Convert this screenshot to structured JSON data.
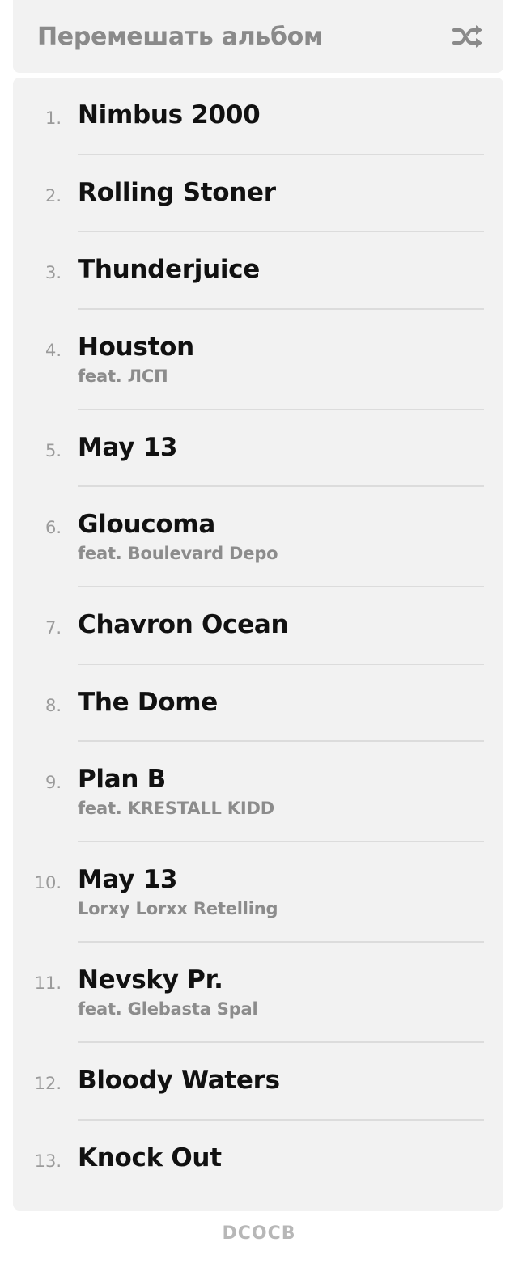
{
  "shuffle": {
    "label": "Перемешать альбом",
    "icon": "shuffle-icon"
  },
  "tracks": [
    {
      "num": "1.",
      "title": "Nimbus 2000",
      "subtitle": ""
    },
    {
      "num": "2.",
      "title": "Rolling Stoner",
      "subtitle": ""
    },
    {
      "num": "3.",
      "title": "Thunderjuice",
      "subtitle": ""
    },
    {
      "num": "4.",
      "title": "Houston",
      "subtitle": "feat. ЛСП"
    },
    {
      "num": "5.",
      "title": "May 13",
      "subtitle": ""
    },
    {
      "num": "6.",
      "title": "Gloucoma",
      "subtitle": "feat. Boulevard Depo"
    },
    {
      "num": "7.",
      "title": "Chavron Ocean",
      "subtitle": ""
    },
    {
      "num": "8.",
      "title": "The Dome",
      "subtitle": ""
    },
    {
      "num": "9.",
      "title": "Plan B",
      "subtitle": "feat. KRESTALL KIDD"
    },
    {
      "num": "10.",
      "title": "May 13",
      "subtitle": "Lorxy Lorxx Retelling"
    },
    {
      "num": "11.",
      "title": "Nevsky Pr.",
      "subtitle": "feat. Glebasta Spal"
    },
    {
      "num": "12.",
      "title": "Bloody Waters",
      "subtitle": ""
    },
    {
      "num": "13.",
      "title": "Knock Out",
      "subtitle": ""
    }
  ],
  "footer": {
    "logo_text": "DCOCB"
  }
}
